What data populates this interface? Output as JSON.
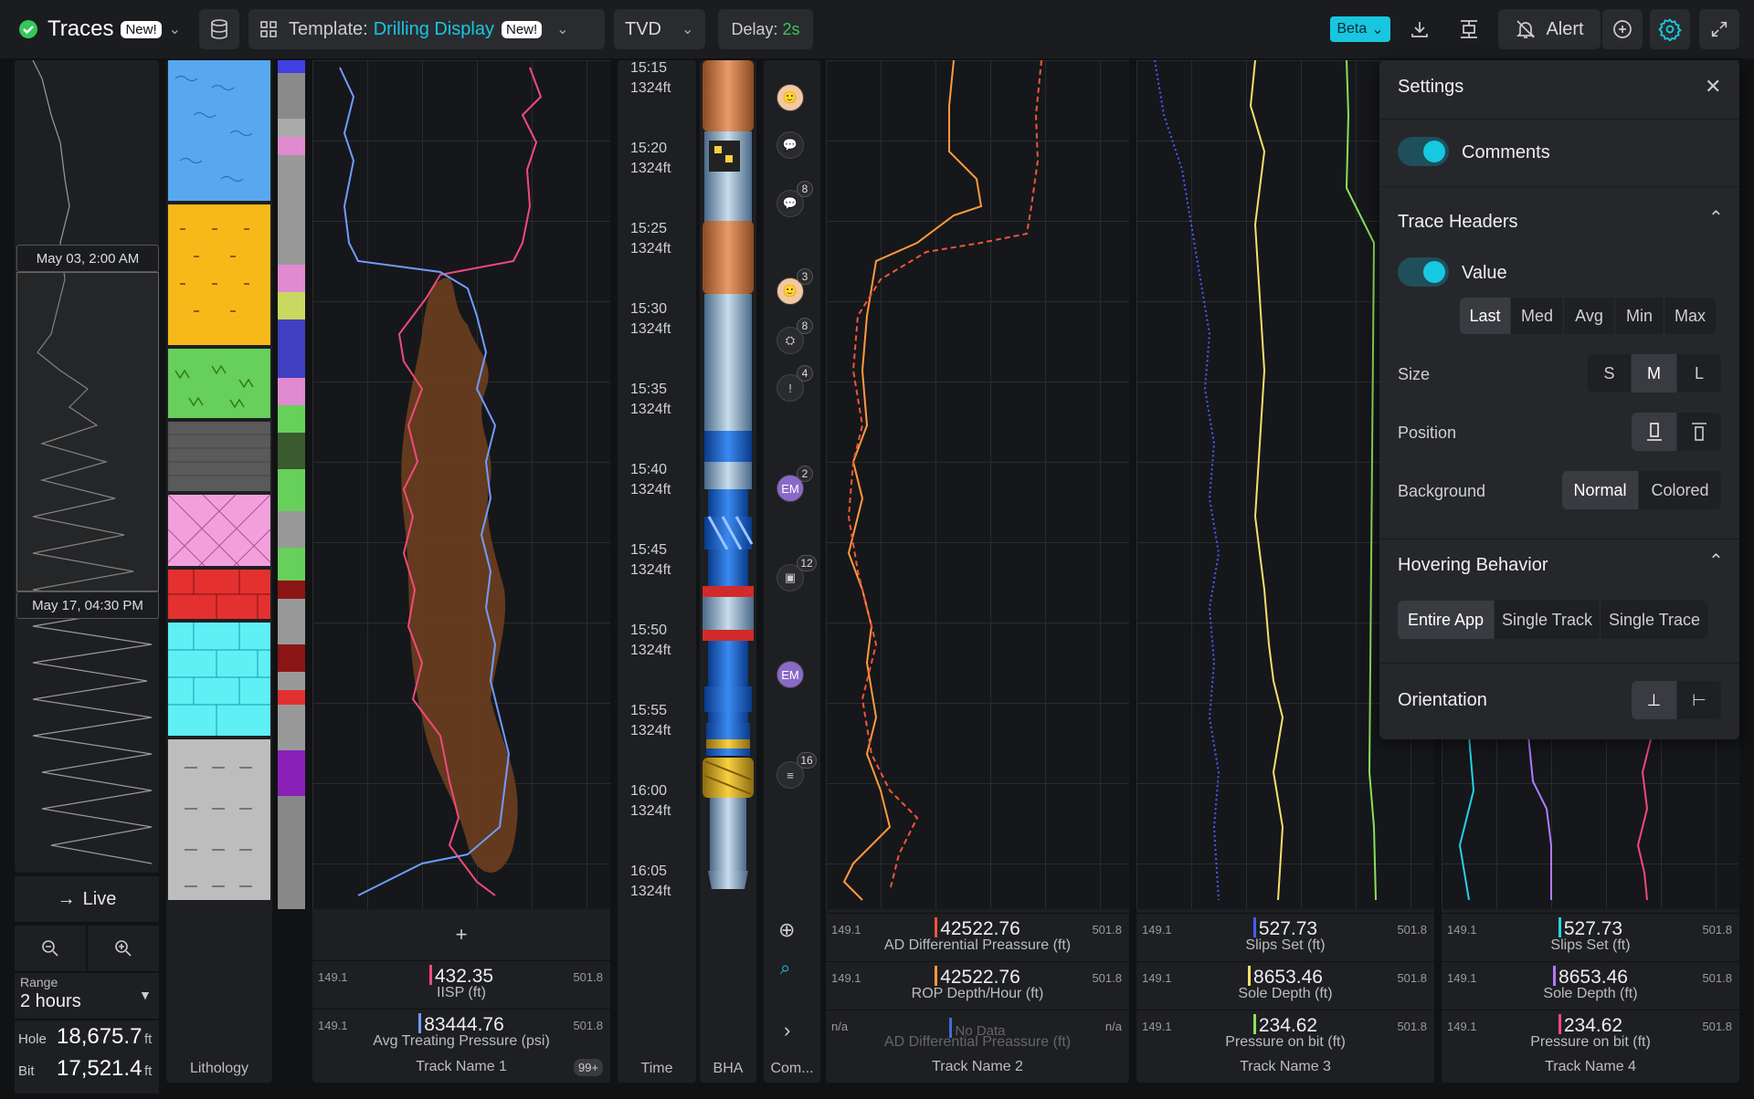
{
  "app": {
    "title": "Traces",
    "new": "New!",
    "template_prefix": "Template:",
    "template_name": "Drilling Display",
    "template_new": "New!",
    "depth_mode": "TVD",
    "delay_label": "Delay:",
    "delay_value": "2s",
    "beta": "Beta",
    "alert": "Alert"
  },
  "overview": {
    "date1": "May 03, 2:00 AM",
    "date2": "May 17, 04:30 PM",
    "live": "Live",
    "range_label": "Range",
    "range_value": "2 hours",
    "hole_label": "Hole",
    "hole_value": "18,675.7",
    "hole_unit": "ft",
    "bit_label": "Bit",
    "bit_value": "17,521.4",
    "bit_unit": "ft"
  },
  "columns": {
    "lithology": "Lithology",
    "time": "Time",
    "bha": "BHA",
    "comments": "Com..."
  },
  "time_ticks": [
    {
      "t": "15:15",
      "d": "1324ft"
    },
    {
      "t": "15:20",
      "d": "1324ft"
    },
    {
      "t": "15:25",
      "d": "1324ft"
    },
    {
      "t": "15:30",
      "d": "1324ft"
    },
    {
      "t": "15:35",
      "d": "1324ft"
    },
    {
      "t": "15:40",
      "d": "1324ft"
    },
    {
      "t": "15:45",
      "d": "1324ft"
    },
    {
      "t": "15:50",
      "d": "1324ft"
    },
    {
      "t": "15:55",
      "d": "1324ft"
    },
    {
      "t": "16:00",
      "d": "1324ft"
    },
    {
      "t": "16:05",
      "d": "1324ft"
    }
  ],
  "comments": {
    "badges": [
      "8",
      "3",
      "8",
      "4",
      "2",
      "12",
      "16"
    ],
    "initials": "EM"
  },
  "tracks": [
    {
      "name": "Track Name 1",
      "count": "99+",
      "headers": [
        {
          "min": "149.1",
          "max": "501.8",
          "value": "432.35",
          "label": "IISP (ft)",
          "color": "#f04a7a"
        },
        {
          "min": "149.1",
          "max": "501.8",
          "value": "83444.76",
          "label": "Avg Treating Pressure (psi)",
          "color": "#6f9cff"
        }
      ]
    },
    {
      "name": "Track Name 2",
      "headers": [
        {
          "min": "149.1",
          "max": "501.8",
          "value": "42522.76",
          "label": "AD Differential Preassure (ft)",
          "color": "#f0553a"
        },
        {
          "min": "149.1",
          "max": "501.8",
          "value": "42522.76",
          "label": "ROP Depth/Hour (ft)",
          "color": "#ff9a3c"
        },
        {
          "min": "n/a",
          "max": "n/a",
          "value": "No Data",
          "label": "AD Differential Preassure (ft)",
          "color": "#3a6fd8"
        }
      ]
    },
    {
      "name": "Track Name 3",
      "headers": [
        {
          "min": "149.1",
          "max": "501.8",
          "value": "527.73",
          "label": "Slips Set (ft)",
          "color": "#4a5cff"
        },
        {
          "min": "149.1",
          "max": "501.8",
          "value": "8653.46",
          "label": "Sole Depth (ft)",
          "color": "#f5e06a"
        },
        {
          "min": "149.1",
          "max": "501.8",
          "value": "234.62",
          "label": "Pressure on bit (ft)",
          "color": "#8ae05a"
        }
      ]
    },
    {
      "name": "Track Name 4",
      "headers": [
        {
          "min": "149.1",
          "max": "501.8",
          "value": "527.73",
          "label": "Slips Set (ft)",
          "color": "#22d3e6"
        },
        {
          "min": "149.1",
          "max": "501.8",
          "value": "8653.46",
          "label": "Sole Depth (ft)",
          "color": "#b07cff"
        },
        {
          "min": "149.1",
          "max": "501.8",
          "value": "234.62",
          "label": "Pressure on bit (ft)",
          "color": "#f04a7a"
        }
      ]
    }
  ],
  "settings": {
    "title": "Settings",
    "comments": "Comments",
    "trace_headers": "Trace Headers",
    "value": "Value",
    "stats": [
      "Last",
      "Med",
      "Avg",
      "Min",
      "Max"
    ],
    "size_label": "Size",
    "sizes": [
      "S",
      "M",
      "L"
    ],
    "position_label": "Position",
    "background_label": "Background",
    "backgrounds": [
      "Normal",
      "Colored"
    ],
    "hovering": "Hovering Behavior",
    "hover_opts": [
      "Entire App",
      "Single Track",
      "Single Trace"
    ],
    "orientation": "Orientation"
  }
}
